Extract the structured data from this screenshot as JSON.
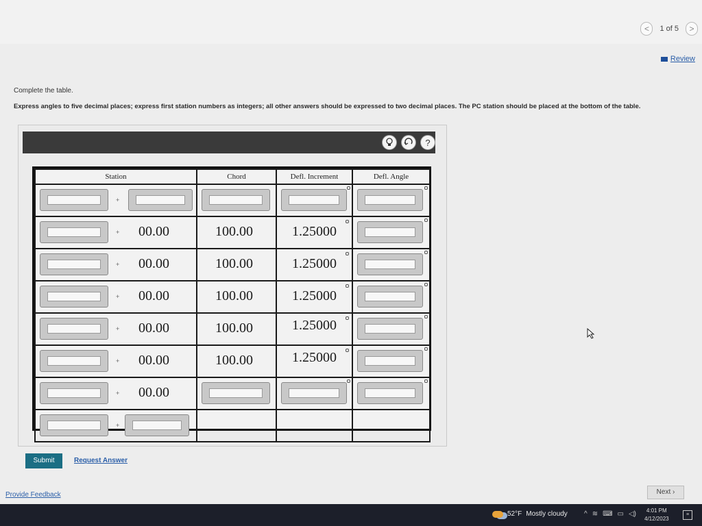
{
  "pager": {
    "prev": "<",
    "text": "1 of 5",
    "next": ">"
  },
  "review_label": "Review",
  "instructions": {
    "line1": "Complete the table.",
    "line2": "Express angles to five decimal places; express first station numbers as integers; all other answers should be expressed to two decimal places. The PC station should be placed at the bottom of the table."
  },
  "toolbar": {
    "hint_icon": "lightbulb-icon",
    "reset_icon": "reset-icon",
    "help_icon": "help-icon",
    "help_glyph": "?"
  },
  "table": {
    "headers": {
      "station": "Station",
      "chord": "Chord",
      "defl_increment": "Defl. Increment",
      "defl_angle": "Defl. Angle"
    },
    "plus": "+",
    "rows": [
      {
        "station_plus": "",
        "chord": "",
        "defl_increment": ""
      },
      {
        "station_plus": "00.00",
        "chord": "100.00",
        "defl_increment": "1.25000"
      },
      {
        "station_plus": "00.00",
        "chord": "100.00",
        "defl_increment": "1.25000"
      },
      {
        "station_plus": "00.00",
        "chord": "100.00",
        "defl_increment": "1.25000"
      },
      {
        "station_plus": "00.00",
        "chord": "100.00",
        "defl_increment": "1.25000"
      },
      {
        "station_plus": "00.00",
        "chord": "100.00",
        "defl_increment": "1.25000"
      },
      {
        "station_plus": "00.00",
        "chord": "",
        "defl_increment": ""
      },
      {
        "station_plus": "",
        "chord": "",
        "defl_increment": ""
      }
    ]
  },
  "buttons": {
    "submit": "Submit",
    "request_answer": "Request Answer",
    "next": "Next"
  },
  "links": {
    "provide_feedback": "Provide Feedback"
  },
  "taskbar": {
    "temperature": "52°F",
    "weather": "Mostly cloudy",
    "time": "4:01 PM",
    "date": "4/12/2023"
  },
  "colors": {
    "submit_bg": "#1b6e84",
    "link": "#2a5ea8",
    "panel_header": "#3a3a3a",
    "taskbar": "#1c1f2a"
  }
}
